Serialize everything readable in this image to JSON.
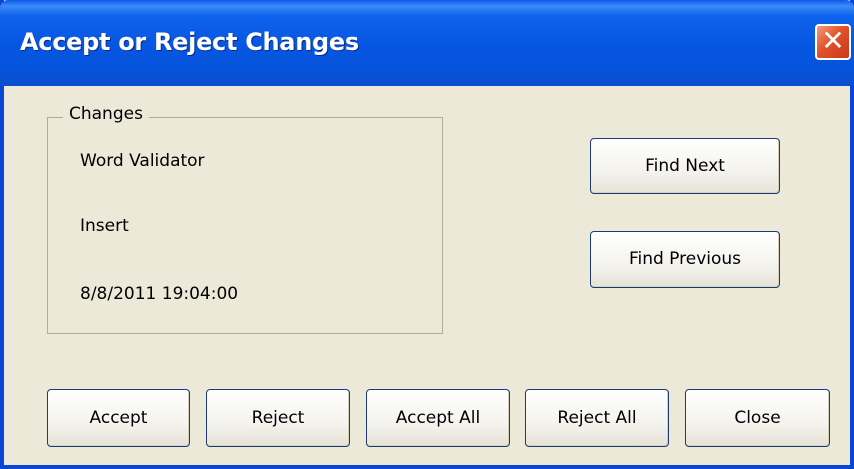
{
  "window": {
    "title": "Accept or Reject Changes",
    "close_glyph": "✕"
  },
  "changes": {
    "group_label": "Changes",
    "author": "Word Validator",
    "type": "Insert",
    "timestamp": "8/8/2011 19:04:00"
  },
  "buttons": {
    "find_next": "Find Next",
    "find_previous": "Find Previous",
    "accept": "Accept",
    "reject": "Reject",
    "accept_all": "Accept All",
    "reject_all": "Reject All",
    "close": "Close"
  },
  "colors": {
    "title_bar": "#0757e3",
    "dialog_bg": "#ece9d8",
    "close_button": "#e0522a"
  }
}
